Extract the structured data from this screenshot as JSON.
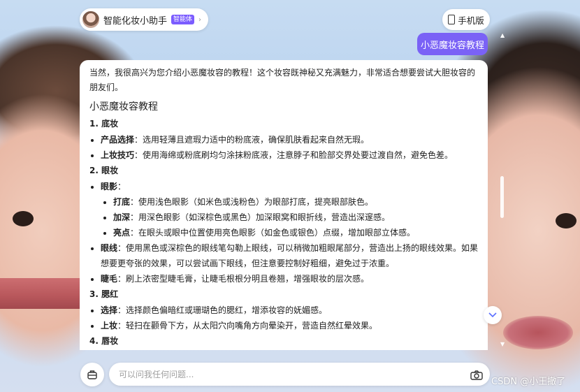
{
  "header": {
    "assistant_name": "智能化妆小助手",
    "assistant_tag": "智能体",
    "mobile_label": "手机版"
  },
  "user_message": "小恶魔妆容教程",
  "answer": {
    "intro": "当然，我很高兴为您介绍小恶魔妆容的教程！这个妆容既神秘又充满魅力，非常适合想要尝试大胆妆容的朋友们。",
    "title": "小恶魔妆容教程",
    "sections": [
      {
        "heading": "1. 底妆",
        "items": [
          {
            "key": "产品选择",
            "text": "：选用轻薄且遮瑕力适中的粉底液，确保肌肤看起来自然无瑕。"
          },
          {
            "key": "上妆技巧",
            "text": "：使用海绵或粉底刷均匀涂抹粉底液，注意脖子和脸部交界处要过渡自然，避免色差。"
          }
        ]
      },
      {
        "heading": "2. 眼妆",
        "items": [
          {
            "key": "眼影",
            "text": "：",
            "sub": [
              {
                "key": "打底",
                "text": "：使用浅色眼影（如米色或浅粉色）为眼部打底，提亮眼部肤色。"
              },
              {
                "key": "加深",
                "text": "：用深色眼影（如深棕色或黑色）加深眼窝和眼折线，营造出深邃感。"
              },
              {
                "key": "亮点",
                "text": "：在眼头或眼中位置使用亮色眼影（如金色或银色）点缀，增加眼部立体感。"
              }
            ]
          },
          {
            "key": "眼线",
            "text": "：使用黑色或深棕色的眼线笔勾勒上眼线，可以稍微加粗眼尾部分，营造出上扬的眼线效果。如果想要更夸张的效果，可以尝试画下眼线，但注意要控制好粗细，避免过于浓重。"
          },
          {
            "key": "睫毛",
            "text": "：刷上浓密型睫毛膏，让睫毛根根分明且卷翘，增强眼妆的层次感。"
          }
        ]
      },
      {
        "heading": "3. 腮红",
        "items": [
          {
            "key": "选择",
            "text": "：选择颜色偏暗红或珊瑚色的腮红，增添妆容的妩媚感。"
          },
          {
            "key": "上妆",
            "text": "：轻扫在颧骨下方，从太阳穴向嘴角方向晕染开，营造自然红晕效果。"
          }
        ]
      },
      {
        "heading": "4. 唇妆",
        "items": []
      }
    ]
  },
  "input": {
    "placeholder": "可以问我任何问题..."
  },
  "watermark": "CSDN @小王撤了",
  "colors": {
    "accent": "#7a62f6",
    "tag": "#7b5cff"
  }
}
